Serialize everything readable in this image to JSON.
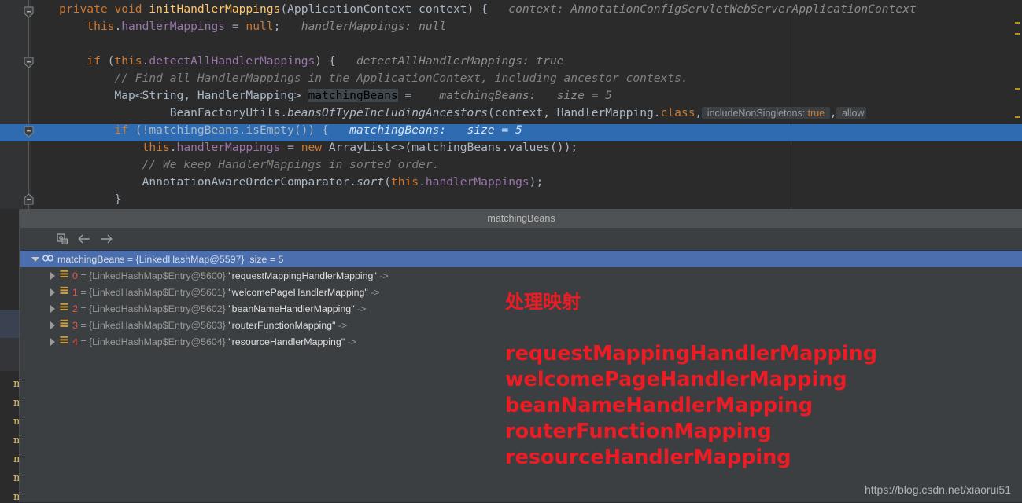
{
  "editor": {
    "margin_guide_x": 965,
    "selected_line_index": 7,
    "lines": [
      {
        "indent": 4,
        "tokens": [
          {
            "t": "private ",
            "c": "kw"
          },
          {
            "t": "void ",
            "c": "kw"
          },
          {
            "t": "initHandlerMappings",
            "c": "fn"
          },
          {
            "t": "(",
            "c": "pl"
          },
          {
            "t": "ApplicationContext context",
            "c": "pl"
          },
          {
            "t": ") {",
            "c": "pl"
          },
          {
            "t": "   context: AnnotationConfigServletWebServerApplicationContext",
            "c": "hint"
          }
        ]
      },
      {
        "indent": 8,
        "tokens": [
          {
            "t": "this",
            "c": "kw"
          },
          {
            "t": ".",
            "c": "pl"
          },
          {
            "t": "handlerMappings",
            "c": "fld"
          },
          {
            "t": " = ",
            "c": "pl"
          },
          {
            "t": "null",
            "c": "kw"
          },
          {
            "t": ";",
            "c": "pl"
          },
          {
            "t": "   handlerMappings: null",
            "c": "hint"
          }
        ]
      },
      {
        "indent": 0,
        "tokens": []
      },
      {
        "indent": 8,
        "tokens": [
          {
            "t": "if ",
            "c": "kw"
          },
          {
            "t": "(",
            "c": "pl"
          },
          {
            "t": "this",
            "c": "kw"
          },
          {
            "t": ".",
            "c": "pl"
          },
          {
            "t": "detectAllHandlerMappings",
            "c": "fld"
          },
          {
            "t": ") {",
            "c": "pl"
          },
          {
            "t": "   detectAllHandlerMappings: true",
            "c": "hint"
          }
        ]
      },
      {
        "indent": 12,
        "tokens": [
          {
            "t": "// Find all HandlerMappings in the ApplicationContext, including ancestor contexts.",
            "c": "cm"
          }
        ]
      },
      {
        "indent": 12,
        "tokens": [
          {
            "t": "Map<String, HandlerMapping> ",
            "c": "pl"
          },
          {
            "t": "matchingBeans",
            "c": "sel-tok"
          },
          {
            "t": " = ",
            "c": "pl"
          },
          {
            "t": "   matchingBeans:   size = 5",
            "c": "hint"
          }
        ]
      },
      {
        "indent": 20,
        "tokens": [
          {
            "t": "BeanFactoryUtils.",
            "c": "pl"
          },
          {
            "t": "beansOfTypeIncludingAncestors",
            "c": "stat-i"
          },
          {
            "t": "(context, HandlerMapping.",
            "c": "pl"
          },
          {
            "t": "class",
            "c": "kw"
          },
          {
            "t": ",",
            "c": "pl"
          },
          {
            "t": "CHIP_includeNonSingletons",
            "c": "chip"
          },
          {
            "t": ",",
            "c": "pl"
          },
          {
            "t": "CHIP_allow",
            "c": "chip2"
          }
        ]
      },
      {
        "indent": 12,
        "tokens": [
          {
            "t": "if ",
            "c": "kw"
          },
          {
            "t": "(!matchingBeans.isEmpty()) {",
            "c": "pl"
          },
          {
            "t": "   matchingBeans:   size = 5",
            "c": "hint-on-blue"
          }
        ]
      },
      {
        "indent": 16,
        "tokens": [
          {
            "t": "this",
            "c": "kw"
          },
          {
            "t": ".",
            "c": "pl"
          },
          {
            "t": "handlerMappings",
            "c": "fld"
          },
          {
            "t": " = ",
            "c": "pl"
          },
          {
            "t": "new ",
            "c": "kw"
          },
          {
            "t": "ArrayList<>(matchingBeans.values())",
            "c": "pl"
          },
          {
            "t": ";",
            "c": "pl"
          }
        ]
      },
      {
        "indent": 16,
        "tokens": [
          {
            "t": "// We keep HandlerMappings in sorted order.",
            "c": "cm"
          }
        ]
      },
      {
        "indent": 16,
        "tokens": [
          {
            "t": "AnnotationAwareOrderComparator.",
            "c": "pl"
          },
          {
            "t": "sort",
            "c": "stat-i"
          },
          {
            "t": "(",
            "c": "pl"
          },
          {
            "t": "this",
            "c": "kw"
          },
          {
            "t": ".",
            "c": "pl"
          },
          {
            "t": "handlerMappings",
            "c": "fld"
          },
          {
            "t": ");",
            "c": "pl"
          }
        ]
      },
      {
        "indent": 12,
        "tokens": [
          {
            "t": "}",
            "c": "pl"
          }
        ]
      }
    ],
    "inlay_chips": [
      {
        "label": "includeNonSingletons:",
        "value": "true"
      },
      {
        "label": "allow",
        "value": ""
      }
    ]
  },
  "panel": {
    "title": "matchingBeans",
    "toolbar": {
      "copy_frames_label": "copy-value",
      "back_label": "back",
      "forward_label": "forward"
    },
    "tree": {
      "root": {
        "expanded": true,
        "name": "matchingBeans",
        "eq": "=",
        "type": "{LinkedHashMap@5597}",
        "size": "size = 5"
      },
      "children": [
        {
          "index": "0",
          "type": "{LinkedHashMap$Entry@5600}",
          "key": "\"requestMappingHandlerMapping\"",
          "arrow": "->"
        },
        {
          "index": "1",
          "type": "{LinkedHashMap$Entry@5601}",
          "key": "\"welcomePageHandlerMapping\"",
          "arrow": "->"
        },
        {
          "index": "2",
          "type": "{LinkedHashMap$Entry@5602}",
          "key": "\"beanNameHandlerMapping\"",
          "arrow": "->"
        },
        {
          "index": "3",
          "type": "{LinkedHashMap$Entry@5603}",
          "key": "\"routerFunctionMapping\"",
          "arrow": "->"
        },
        {
          "index": "4",
          "type": "{LinkedHashMap$Entry@5604}",
          "key": "\"resourceHandlerMapping\"",
          "arrow": "->"
        }
      ]
    }
  },
  "left_strip": {
    "glyph": "m",
    "glyph_count": 7
  },
  "annotations": {
    "color": "#ED1C24",
    "heading": "处理映射",
    "items": [
      "requestMappingHandlerMapping",
      "welcomePageHandlerMapping",
      "beanNameHandlerMapping",
      "routerFunctionMapping",
      "resourceHandlerMapping"
    ]
  },
  "watermark": "https://blog.csdn.net/xiaorui51"
}
